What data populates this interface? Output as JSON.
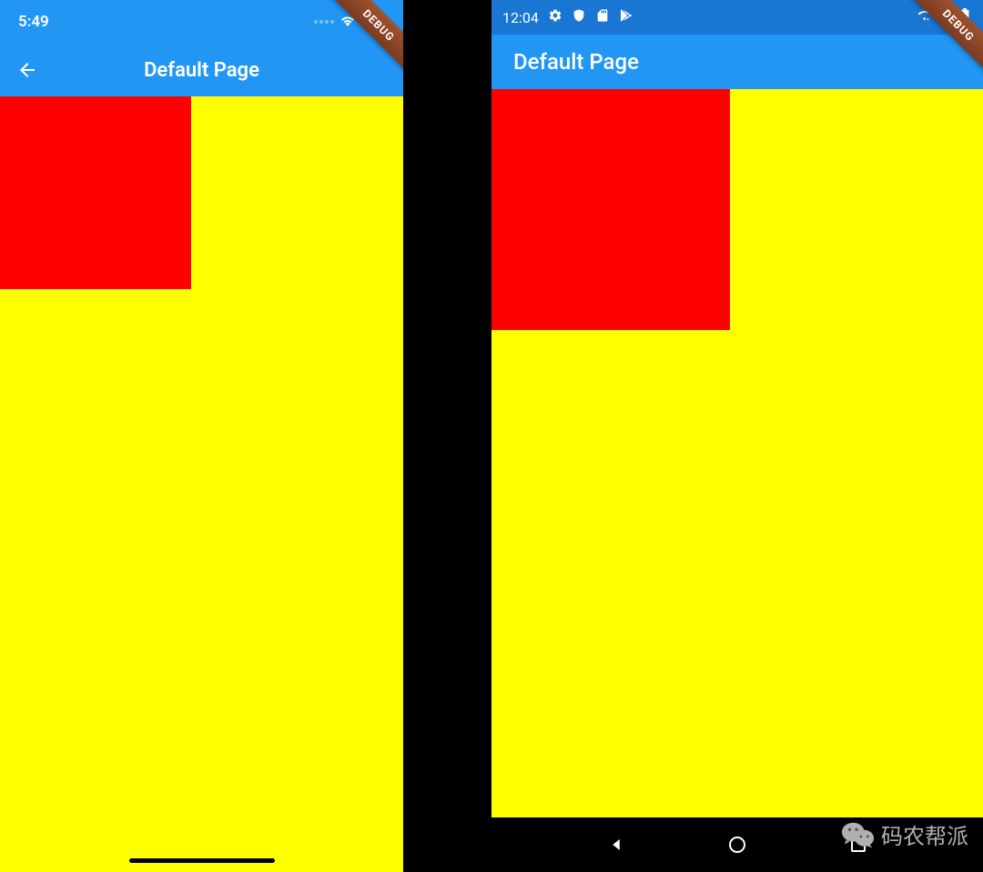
{
  "ios": {
    "statusbar": {
      "time": "5:49"
    },
    "appbar": {
      "title": "Default Page"
    },
    "debug_label": "DEBUG"
  },
  "android": {
    "statusbar": {
      "time": "12:04"
    },
    "appbar": {
      "title": "Default Page"
    },
    "debug_label": "DEBUG"
  },
  "watermark": {
    "text": "码农帮派"
  },
  "colors": {
    "appbar_bg": "#2196F3",
    "statusbar_android": "#1976D2",
    "body_bg": "#ffff00",
    "box_bg": "#ff0000"
  }
}
